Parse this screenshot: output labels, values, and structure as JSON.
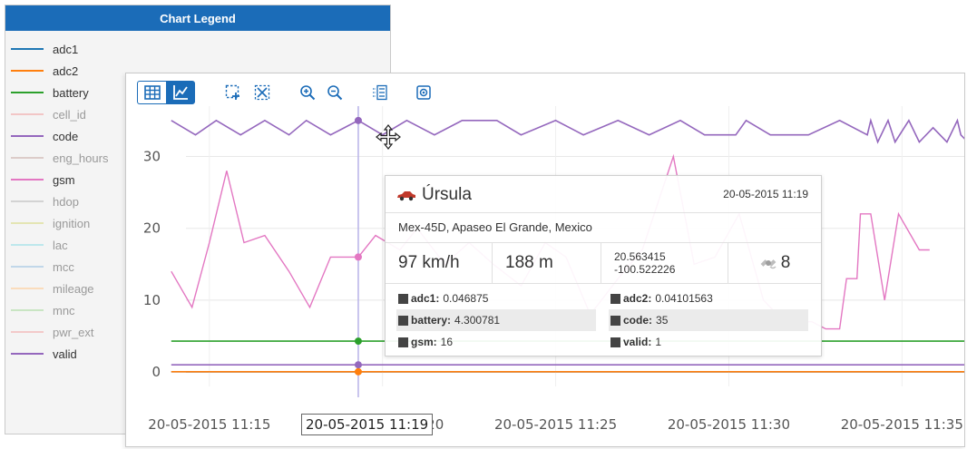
{
  "legend": {
    "title": "Chart Legend",
    "items": [
      {
        "label": "adc1",
        "color": "#1f77b4",
        "active": true
      },
      {
        "label": "adc2",
        "color": "#ff7f0e",
        "active": true
      },
      {
        "label": "battery",
        "color": "#2ca02c",
        "active": true
      },
      {
        "label": "cell_id",
        "color": "#f0a0a0",
        "active": false
      },
      {
        "label": "code",
        "color": "#9467bd",
        "active": true
      },
      {
        "label": "eng_hours",
        "color": "#c8aca5",
        "active": false
      },
      {
        "label": "gsm",
        "color": "#e377c2",
        "active": true
      },
      {
        "label": "hdop",
        "color": "#b8b8b8",
        "active": false
      },
      {
        "label": "ignition",
        "color": "#d7d880",
        "active": false
      },
      {
        "label": "lac",
        "color": "#8fdde6",
        "active": false
      },
      {
        "label": "mcc",
        "color": "#98bfe0",
        "active": false
      },
      {
        "label": "mileage",
        "color": "#ffc88e",
        "active": false
      },
      {
        "label": "mnc",
        "color": "#a5d99a",
        "active": false
      },
      {
        "label": "pwr_ext",
        "color": "#f2a6a6",
        "active": false
      },
      {
        "label": "valid",
        "color": "#9467bd",
        "active": true
      }
    ]
  },
  "toolbar": {
    "icons": [
      "table-icon",
      "line-chart-icon",
      "zoom-select-icon",
      "zoom-fit-icon",
      "zoom-in-icon",
      "zoom-out-icon",
      "list-icon",
      "snapshot-icon"
    ]
  },
  "crosshair": {
    "label": "20-05-2015 11:19",
    "x_minutes": 19.3
  },
  "tooltip": {
    "name": "Úrsula",
    "time": "20-05-2015 11:19",
    "address": "Mex-45D, Apaseo El Grande, Mexico",
    "speed": "97 km/h",
    "altitude": "188 m",
    "lat": "20.563415",
    "lon": "-100.522226",
    "satellites": "8",
    "params": [
      [
        {
          "name": "adc1:",
          "value": "0.046875"
        },
        {
          "name": "adc2:",
          "value": "0.04101563"
        }
      ],
      [
        {
          "name": "battery:",
          "value": "4.300781"
        },
        {
          "name": "code:",
          "value": "35"
        }
      ],
      [
        {
          "name": "gsm:",
          "value": "16"
        },
        {
          "name": "valid:",
          "value": "1"
        }
      ]
    ]
  },
  "chart_data": {
    "type": "line",
    "x_ticks": [
      "20-05-2015 11:15",
      "20-05-2015 11:20",
      "20-05-2015 11:25",
      "20-05-2015 11:30",
      "20-05-2015 11:35"
    ],
    "y_ticks": [
      "0",
      "10",
      "20",
      "30"
    ],
    "ylim": [
      -2,
      37
    ],
    "xlim_minutes": [
      13.8,
      36.8
    ],
    "x_unit": "minutes past 11:00 on 20-05-2015",
    "grid": true,
    "series": [
      {
        "name": "code",
        "color": "#9467bd",
        "points": [
          [
            13.9,
            35
          ],
          [
            14.6,
            33
          ],
          [
            15.2,
            35
          ],
          [
            15.9,
            33
          ],
          [
            16.6,
            35
          ],
          [
            17.3,
            33
          ],
          [
            17.8,
            35
          ],
          [
            18.5,
            33
          ],
          [
            19.3,
            35
          ],
          [
            20.0,
            33
          ],
          [
            20.7,
            35
          ],
          [
            21.5,
            33
          ],
          [
            22.3,
            35
          ],
          [
            23.3,
            35
          ],
          [
            24.0,
            33
          ],
          [
            25.0,
            35
          ],
          [
            25.8,
            33
          ],
          [
            26.8,
            35
          ],
          [
            27.7,
            33
          ],
          [
            28.6,
            35
          ],
          [
            29.3,
            33
          ],
          [
            30.2,
            33
          ],
          [
            30.5,
            35
          ],
          [
            31.2,
            33
          ],
          [
            32.3,
            33
          ],
          [
            33.2,
            35
          ],
          [
            34.0,
            33
          ],
          [
            34.1,
            35
          ],
          [
            34.3,
            32
          ],
          [
            34.6,
            35
          ],
          [
            34.8,
            32
          ],
          [
            35.2,
            35
          ],
          [
            35.5,
            32
          ],
          [
            35.9,
            34
          ],
          [
            36.3,
            32
          ],
          [
            36.6,
            35
          ],
          [
            36.7,
            33
          ],
          [
            36.9,
            32
          ]
        ]
      },
      {
        "name": "gsm",
        "color": "#e377c2",
        "points": [
          [
            13.9,
            14
          ],
          [
            14.5,
            9
          ],
          [
            15.0,
            18
          ],
          [
            15.5,
            28
          ],
          [
            16.0,
            18
          ],
          [
            16.6,
            19
          ],
          [
            17.3,
            14
          ],
          [
            17.9,
            9
          ],
          [
            18.5,
            16
          ],
          [
            19.3,
            16
          ],
          [
            19.8,
            19
          ],
          [
            20.5,
            17
          ],
          [
            21.0,
            20
          ],
          [
            21.8,
            15
          ],
          [
            22.5,
            18
          ],
          [
            23.2,
            15
          ],
          [
            24.0,
            12
          ],
          [
            24.7,
            18
          ],
          [
            25.3,
            16
          ],
          [
            26.0,
            8
          ],
          [
            26.8,
            13
          ],
          [
            27.5,
            17
          ],
          [
            28.4,
            30
          ],
          [
            29.0,
            15
          ],
          [
            29.6,
            16
          ],
          [
            30.3,
            22
          ],
          [
            31.0,
            10
          ],
          [
            31.6,
            7
          ],
          [
            32.4,
            7
          ],
          [
            32.8,
            6
          ],
          [
            33.2,
            6
          ],
          [
            33.4,
            13
          ],
          [
            33.7,
            13
          ],
          [
            33.8,
            22
          ],
          [
            34.1,
            22
          ],
          [
            34.5,
            10
          ],
          [
            34.9,
            22
          ],
          [
            35.5,
            17
          ],
          [
            35.8,
            17
          ]
        ]
      },
      {
        "name": "battery",
        "color": "#2ca02c",
        "points": [
          [
            13.9,
            4.3
          ],
          [
            36.8,
            4.3
          ]
        ]
      },
      {
        "name": "valid",
        "color": "#9467bd",
        "points": [
          [
            13.9,
            1
          ],
          [
            36.8,
            1
          ]
        ]
      },
      {
        "name": "adc1",
        "color": "#1f77b4",
        "points": [
          [
            13.9,
            0.05
          ],
          [
            36.8,
            0.05
          ]
        ]
      },
      {
        "name": "adc2",
        "color": "#ff7f0e",
        "points": [
          [
            13.9,
            0.04
          ],
          [
            36.8,
            0.04
          ]
        ]
      }
    ],
    "markers": [
      {
        "series": "code",
        "x": 19.3,
        "y": 35,
        "color": "#9467bd"
      },
      {
        "series": "gsm",
        "x": 19.3,
        "y": 16,
        "color": "#e377c2"
      },
      {
        "series": "battery",
        "x": 19.3,
        "y": 4.3,
        "color": "#2ca02c"
      },
      {
        "series": "valid",
        "x": 19.3,
        "y": 1,
        "color": "#9467bd"
      },
      {
        "series": "adc2",
        "x": 19.3,
        "y": 0.04,
        "color": "#ff7f0e"
      }
    ]
  }
}
